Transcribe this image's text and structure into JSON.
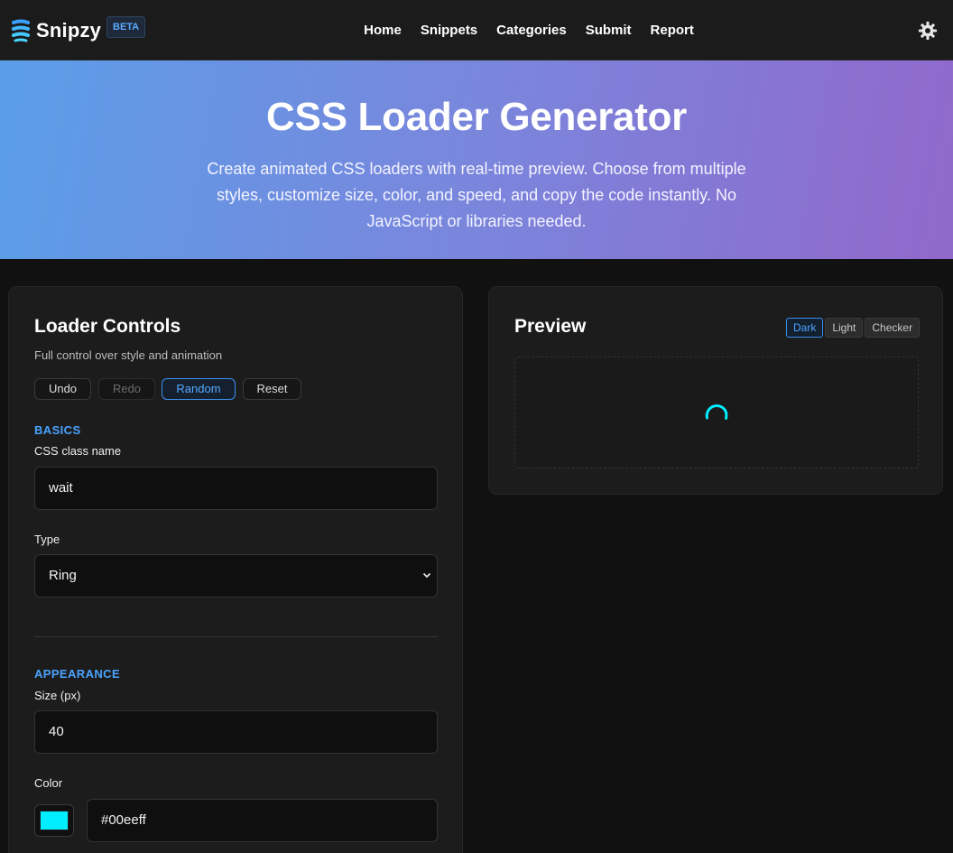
{
  "brand": {
    "name": "Snipzy",
    "badge": "BETA",
    "accent": "#4aa3ff"
  },
  "nav": {
    "links": [
      "Home",
      "Snippets",
      "Categories",
      "Submit",
      "Report"
    ],
    "settings_icon": "gear-icon"
  },
  "hero": {
    "title": "CSS Loader Generator",
    "description": "Create animated CSS loaders with real-time preview. Choose from multiple styles, customize size, color, and speed, and copy the code instantly. No JavaScript or libraries needed."
  },
  "controls": {
    "title": "Loader Controls",
    "subtitle": "Full control over style and animation",
    "buttons": {
      "undo": "Undo",
      "redo": "Redo",
      "random": "Random",
      "reset": "Reset"
    },
    "basics": {
      "section": "BASICS",
      "class_label": "CSS class name",
      "class_value": "wait",
      "type_label": "Type",
      "type_value": "Ring"
    },
    "appearance": {
      "section": "APPEARANCE",
      "size_label": "Size (px)",
      "size_value": "40",
      "color_label": "Color",
      "color_value": "#00eeff"
    }
  },
  "preview": {
    "title": "Preview",
    "backgrounds": [
      "Dark",
      "Light",
      "Checker"
    ],
    "selected_background": "Dark",
    "loader_color": "#00eeff"
  }
}
